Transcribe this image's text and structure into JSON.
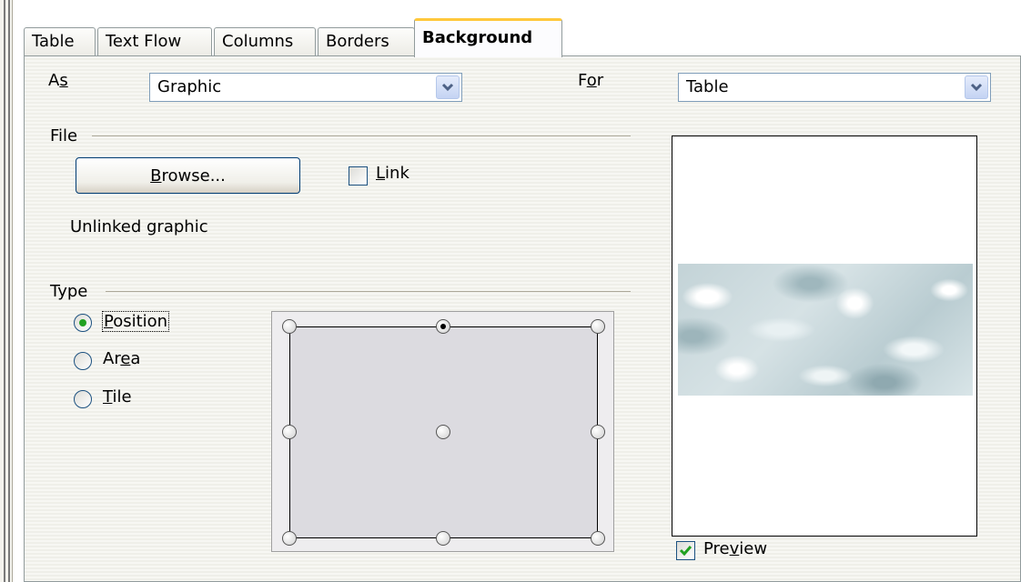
{
  "tabs": [
    {
      "label": "Table"
    },
    {
      "label": "Text Flow"
    },
    {
      "label": "Columns"
    },
    {
      "label": "Borders"
    },
    {
      "label": "Background"
    }
  ],
  "active_tab": "Background",
  "as": {
    "label_pre": "A",
    "label_ul": "s",
    "value": "Graphic"
  },
  "for": {
    "label_pre": "F",
    "label_ul": "o",
    "label_post": "r",
    "value": "Table"
  },
  "file": {
    "group_label": "File",
    "browse": {
      "ul": "B",
      "rest": "rowse..."
    },
    "link": {
      "ul": "L",
      "rest": "ink",
      "checked": false
    },
    "status": "Unlinked graphic"
  },
  "type": {
    "group_label": "Type",
    "options": [
      {
        "ul": "P",
        "pre": "",
        "rest": "osition",
        "checked": true
      },
      {
        "pre": "Ar",
        "ul": "e",
        "rest": "a",
        "checked": false
      },
      {
        "pre": "",
        "ul": "T",
        "rest": "ile",
        "checked": false
      }
    ],
    "selected_position": "top-center"
  },
  "preview": {
    "pre": "Pre",
    "ul": "v",
    "rest": "iew",
    "checked": true
  },
  "colors": {
    "active_tab_accent": "#ffc83c",
    "panel_border": "#919b9c",
    "checkmark": "#21a121"
  }
}
